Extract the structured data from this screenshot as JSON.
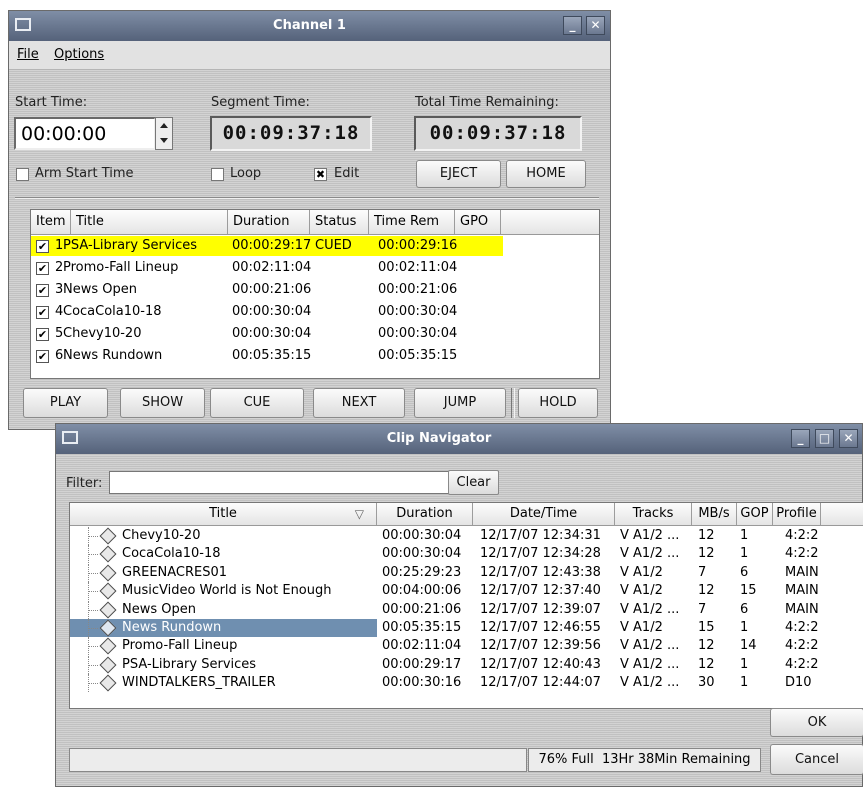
{
  "channel": {
    "title": "Channel 1",
    "menu": [
      "File",
      "Options"
    ],
    "start_time_label": "Start Time:",
    "start_time_value": "00:00:00",
    "segment_time_label": "Segment Time:",
    "segment_time_value": "00:09:37:18",
    "total_remaining_label": "Total Time Remaining:",
    "total_remaining_value": "00:09:37:18",
    "arm_start_label": "Arm Start Time",
    "loop_label": "Loop",
    "edit_label": "Edit",
    "eject_label": "EJECT",
    "home_label": "HOME",
    "columns": [
      "Item",
      "Title",
      "Duration",
      "Status",
      "Time Rem",
      "GPO"
    ],
    "rows": [
      {
        "item": "1",
        "title": "PSA-Library Services",
        "duration": "00:00:29:17",
        "status": "CUED",
        "time_rem": "00:00:29:16"
      },
      {
        "item": "2",
        "title": "Promo-Fall Lineup",
        "duration": "00:02:11:04",
        "status": "",
        "time_rem": "00:02:11:04"
      },
      {
        "item": "3",
        "title": "News Open",
        "duration": "00:00:21:06",
        "status": "",
        "time_rem": "00:00:21:06"
      },
      {
        "item": "4",
        "title": "CocaCola10-18",
        "duration": "00:00:30:04",
        "status": "",
        "time_rem": "00:00:30:04"
      },
      {
        "item": "5",
        "title": "Chevy10-20",
        "duration": "00:00:30:04",
        "status": "",
        "time_rem": "00:00:30:04"
      },
      {
        "item": "6",
        "title": "News Rundown",
        "duration": "00:05:35:15",
        "status": "",
        "time_rem": "00:05:35:15"
      }
    ],
    "buttons": [
      "PLAY",
      "SHOW",
      "CUE",
      "NEXT",
      "JUMP",
      "HOLD"
    ],
    "highlight_color": "#ffff00"
  },
  "clipnav": {
    "title": "Clip Navigator",
    "filter_label": "Filter:",
    "filter_value": "",
    "clear_label": "Clear",
    "columns": [
      "Title",
      "Duration",
      "Date/Time",
      "Tracks",
      "MB/s",
      "GOP",
      "Profile"
    ],
    "rows": [
      {
        "title": "Chevy10-20",
        "duration": "00:00:30:04",
        "datetime": "12/17/07 12:34:31",
        "tracks": "V A1/2 ...",
        "mbs": "12",
        "gop": "1",
        "profile": "4:2:2"
      },
      {
        "title": "CocaCola10-18",
        "duration": "00:00:30:04",
        "datetime": "12/17/07 12:34:28",
        "tracks": "V A1/2 ...",
        "mbs": "12",
        "gop": "1",
        "profile": "4:2:2"
      },
      {
        "title": "GREENACRES01",
        "duration": "00:25:29:23",
        "datetime": "12/17/07 12:43:38",
        "tracks": "V A1/2",
        "mbs": "7",
        "gop": "6",
        "profile": "MAIN"
      },
      {
        "title": "MusicVideo World is Not Enough",
        "duration": "00:04:00:06",
        "datetime": "12/17/07 12:37:40",
        "tracks": "V A1/2",
        "mbs": "12",
        "gop": "15",
        "profile": "MAIN"
      },
      {
        "title": "News Open",
        "duration": "00:00:21:06",
        "datetime": "12/17/07 12:39:07",
        "tracks": "V A1/2 ...",
        "mbs": "7",
        "gop": "6",
        "profile": "MAIN"
      },
      {
        "title": "News Rundown",
        "duration": "00:05:35:15",
        "datetime": "12/17/07 12:46:55",
        "tracks": "V A1/2",
        "mbs": "15",
        "gop": "1",
        "profile": "4:2:2"
      },
      {
        "title": "Promo-Fall Lineup",
        "duration": "00:02:11:04",
        "datetime": "12/17/07 12:39:56",
        "tracks": "V A1/2 ...",
        "mbs": "12",
        "gop": "14",
        "profile": "4:2:2"
      },
      {
        "title": "PSA-Library Services",
        "duration": "00:00:29:17",
        "datetime": "12/17/07 12:40:43",
        "tracks": "V A1/2 ...",
        "mbs": "12",
        "gop": "1",
        "profile": "4:2:2"
      },
      {
        "title": "WINDTALKERS_TRAILER",
        "duration": "00:00:30:16",
        "datetime": "12/17/07 12:44:07",
        "tracks": "V A1/2 ...",
        "mbs": "30",
        "gop": "1",
        "profile": "D10"
      }
    ],
    "selected_index": 5,
    "ok_label": "OK",
    "cancel_label": "Cancel",
    "disk_status": "76% Full  13Hr 38Min Remaining",
    "selection_color": "#6f8fb0"
  }
}
